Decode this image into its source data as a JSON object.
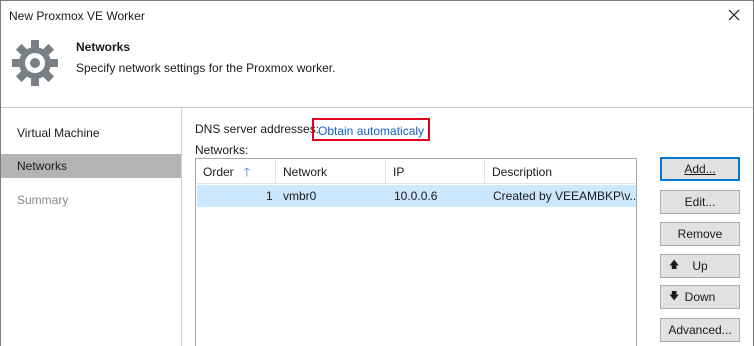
{
  "window": {
    "title": "New Proxmox VE Worker"
  },
  "header": {
    "title": "Networks",
    "subtitle": "Specify network settings for the Proxmox worker.",
    "icon": "gear-icon"
  },
  "sidebar": {
    "items": [
      {
        "label": "Virtual Machine",
        "state": "normal"
      },
      {
        "label": "Networks",
        "state": "active"
      },
      {
        "label": "Summary",
        "state": "disabled"
      }
    ]
  },
  "dns": {
    "label": "DNS server addresses:",
    "link": "Obtain automaticaly"
  },
  "networks": {
    "label": "Networks:",
    "columns": [
      "Order",
      "Network",
      "IP",
      "Description"
    ],
    "sort_column": "Order",
    "sort_direction": "ascending",
    "rows": [
      {
        "order": "1",
        "network": "vmbr0",
        "ip": "10.0.0.6",
        "description": "Created by VEEAMBKP\\v..."
      }
    ]
  },
  "buttons": {
    "add": "Add...",
    "edit": "Edit...",
    "remove": "Remove",
    "up": "Up",
    "down": "Down",
    "advanced": "Advanced..."
  },
  "colors": {
    "selection": "#cce8ff",
    "active_nav": "#b3b3b3",
    "link": "#1160c8",
    "highlight_border": "#e3001b",
    "default_button_border": "#0078d7"
  }
}
